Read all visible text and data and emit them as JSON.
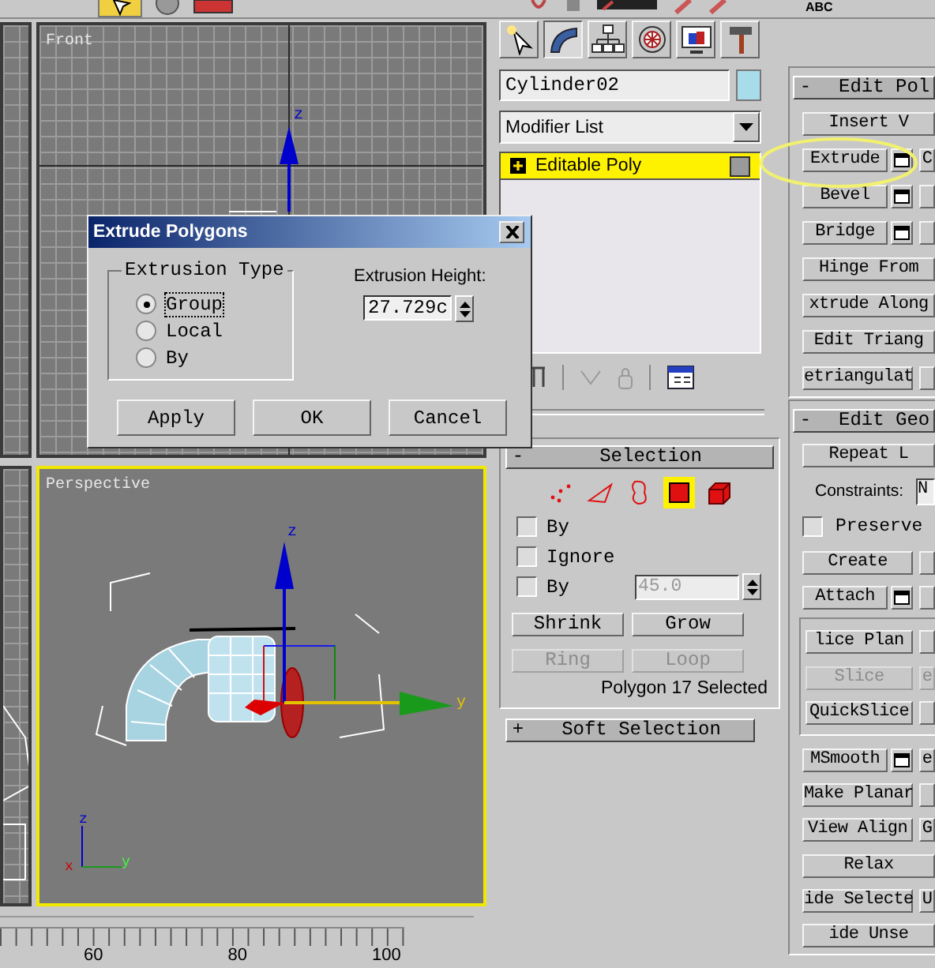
{
  "toolbar": {
    "text": "ABC"
  },
  "viewports": [
    {
      "label": "Front",
      "selected": false,
      "gizmo_labels": [
        "z"
      ]
    },
    {
      "label": "Perspective",
      "selected": true,
      "gizmo_labels": [
        "z",
        "y"
      ],
      "tripod_labels": [
        "z",
        "x",
        "y"
      ]
    }
  ],
  "time_ruler": {
    "labels": [
      "60",
      "80",
      "100"
    ]
  },
  "command_panel": {
    "tabs": [
      {
        "kind": "create",
        "selected": false
      },
      {
        "kind": "modify",
        "selected": true
      },
      {
        "kind": "hierarchy",
        "selected": false
      },
      {
        "kind": "motion",
        "selected": false
      },
      {
        "kind": "display",
        "selected": false
      },
      {
        "kind": "utilities",
        "selected": false
      }
    ],
    "object": {
      "name": "Cylinder02",
      "color": "#a8dcea"
    },
    "modifier_list": {
      "value": "Modifier List"
    },
    "stack": [
      {
        "label": "Editable Poly",
        "selected": true,
        "expanded": false
      }
    ],
    "selection": {
      "sign": "-",
      "title": "Selection",
      "subobjects": [
        {
          "kind": "vertex",
          "selected": false
        },
        {
          "kind": "edge",
          "selected": false
        },
        {
          "kind": "border",
          "selected": false
        },
        {
          "kind": "polygon",
          "selected": true
        },
        {
          "kind": "element",
          "selected": false
        }
      ],
      "options": [
        {
          "label": "By",
          "checked": false
        },
        {
          "label": "Ignore",
          "checked": false
        },
        {
          "label": "By",
          "checked": false
        }
      ],
      "angle": {
        "value": "45.0",
        "disabled": true
      },
      "buttons": [
        {
          "label": "Shrink",
          "disabled": false
        },
        {
          "label": "Grow",
          "disabled": false
        },
        {
          "label": "Ring",
          "disabled": true
        },
        {
          "label": "Loop",
          "disabled": true
        }
      ],
      "status": "Polygon 17 Selected"
    },
    "soft_selection": {
      "sign": "+",
      "title": "Soft Selection"
    }
  },
  "right_panel": [
    {
      "sign": "-",
      "title": "Edit Pol",
      "rows": [
        {
          "kind": "buttons",
          "buttons": [
            {
              "label": "Insert V",
              "disabled": false
            }
          ]
        },
        {
          "kind": "buttons",
          "buttons": [
            {
              "label": "Extrude",
              "disabled": false,
              "settings": true
            },
            {
              "label": "C",
              "disabled": false
            }
          ]
        },
        {
          "kind": "buttons",
          "buttons": [
            {
              "label": "Bevel",
              "disabled": false,
              "settings": true
            },
            {
              "disabled": false
            }
          ]
        },
        {
          "kind": "buttons",
          "buttons": [
            {
              "label": "Bridge",
              "disabled": false,
              "settings": true
            },
            {
              "disabled": false
            }
          ]
        },
        {
          "kind": "buttons",
          "buttons": [
            {
              "label": "Hinge From",
              "disabled": false
            }
          ]
        },
        {
          "kind": "buttons",
          "buttons": [
            {
              "label": "xtrude Along",
              "disabled": false
            }
          ]
        },
        {
          "kind": "buttons",
          "buttons": [
            {
              "label": "Edit Triang",
              "disabled": false
            }
          ]
        },
        {
          "kind": "buttons",
          "buttons": [
            {
              "label": "etriangulat",
              "disabled": false
            },
            {
              "disabled": false
            }
          ]
        }
      ]
    },
    {
      "sign": "-",
      "title": "Edit Geo",
      "rows": [
        {
          "kind": "buttons",
          "buttons": [
            {
              "label": "Repeat L",
              "disabled": false
            }
          ]
        },
        {
          "kind": "field",
          "label": "Constraints:",
          "value": "N"
        },
        {
          "kind": "checkbox",
          "label": "Preserve",
          "checked": false
        },
        {
          "kind": "buttons",
          "buttons": [
            {
              "label": "Create",
              "disabled": false
            },
            {
              "disabled": false
            }
          ]
        },
        {
          "kind": "buttons",
          "buttons": [
            {
              "label": "Attach",
              "disabled": false,
              "settings": true
            },
            {
              "disabled": false
            }
          ]
        },
        {
          "kind": "group",
          "rows": [
            {
              "kind": "buttons",
              "buttons": [
                {
                  "label": "lice Plan",
                  "disabled": false
                },
                {
                  "disabled": false
                }
              ]
            },
            {
              "kind": "buttons",
              "buttons": [
                {
                  "label": "Slice",
                  "disabled": true
                },
                {
                  "label": "e",
                  "disabled": true
                }
              ]
            },
            {
              "kind": "buttons",
              "buttons": [
                {
                  "label": "QuickSlice",
                  "disabled": false
                },
                {
                  "disabled": false
                }
              ]
            }
          ]
        },
        {
          "kind": "buttons",
          "buttons": [
            {
              "label": "MSmooth",
              "disabled": false,
              "settings": true
            },
            {
              "label": "e",
              "disabled": false
            }
          ]
        },
        {
          "kind": "buttons",
          "buttons": [
            {
              "label": "Make Planar",
              "disabled": false
            },
            {
              "disabled": false
            }
          ]
        },
        {
          "kind": "buttons",
          "buttons": [
            {
              "label": "View Align",
              "disabled": false
            },
            {
              "label": "G",
              "disabled": false
            }
          ]
        },
        {
          "kind": "buttons",
          "buttons": [
            {
              "label": "Relax",
              "disabled": false
            }
          ]
        },
        {
          "kind": "buttons",
          "buttons": [
            {
              "label": "ide Selecte",
              "disabled": false
            },
            {
              "label": "U",
              "disabled": false
            }
          ]
        },
        {
          "kind": "buttons",
          "buttons": [
            {
              "label": "ide Unse",
              "disabled": false
            }
          ]
        }
      ]
    }
  ],
  "dialog": {
    "title": "Extrude Polygons",
    "group": "Extrusion Type",
    "types": [
      {
        "label": "Group",
        "selected": true
      },
      {
        "label": "Local",
        "selected": false
      },
      {
        "label": "By",
        "selected": false
      }
    ],
    "height_label": "Extrusion Height:",
    "height_value": "27.729c",
    "buttons": [
      "Apply",
      "OK",
      "Cancel"
    ]
  }
}
